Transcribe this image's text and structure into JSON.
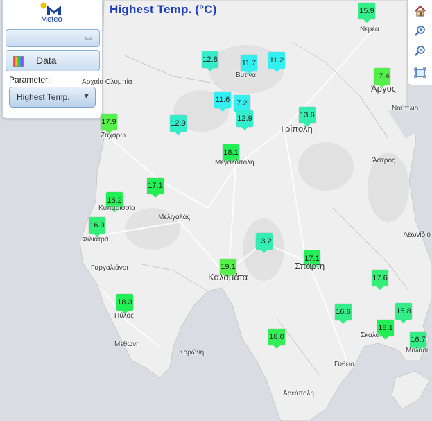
{
  "title": "Highest Temp. (°C)",
  "logo_text": "Meteo",
  "panel": {
    "data_label": "Data",
    "parameter_label": "Parameter:",
    "parameter_value": "Highest Temp."
  },
  "colors": {
    "title": "#1f3fbf",
    "sea": "#d9dde3",
    "land": "#efefef",
    "cyan_marker": "#33f0ef",
    "green_marker": "#22ee55",
    "lime_marker": "#55f04a"
  },
  "tool_icons": [
    "home-icon",
    "zoom-in-icon",
    "zoom-out-icon",
    "fit-extent-icon"
  ],
  "stations": [
    {
      "value": "15.9",
      "color": "#33ee88"
    },
    {
      "value": "12.8",
      "color": "#33eec8"
    },
    {
      "value": "11.7",
      "color": "#33f0f0"
    },
    {
      "value": "11.2",
      "color": "#33f0f0"
    },
    {
      "value": "17.4",
      "color": "#55f04a"
    },
    {
      "value": "11.6",
      "color": "#33f0f0"
    },
    {
      "value": "7.2",
      "color": "#33f0f0"
    },
    {
      "value": "12.9",
      "color": "#33eec8"
    },
    {
      "value": "13.6",
      "color": "#33eeb0"
    },
    {
      "value": "17.9",
      "color": "#55f04a"
    },
    {
      "value": "12.9",
      "color": "#33eec8"
    },
    {
      "value": "18.1",
      "color": "#22ee55"
    },
    {
      "value": "17.1",
      "color": "#22ee55"
    },
    {
      "value": "18.2",
      "color": "#22ee55"
    },
    {
      "value": "16.9",
      "color": "#33ee77"
    },
    {
      "value": "13.2",
      "color": "#33eeb0"
    },
    {
      "value": "17.1",
      "color": "#22ee55"
    },
    {
      "value": "19.1",
      "color": "#55f04a"
    },
    {
      "value": "17.6",
      "color": "#33ee77"
    },
    {
      "value": "18.3",
      "color": "#22ee55"
    },
    {
      "value": "16.6",
      "color": "#33ee88"
    },
    {
      "value": "15.8",
      "color": "#33ee88"
    },
    {
      "value": "18.1",
      "color": "#22ee55"
    },
    {
      "value": "18.0",
      "color": "#33ee55"
    },
    {
      "value": "16.7",
      "color": "#33ee88"
    }
  ],
  "places": [
    "Νεμέα",
    "Αρχαία Ολυμπία",
    "Βυτίνα",
    "Άργος",
    "Ναύπλιο",
    "Τρίπολη",
    "Ζαχάρω",
    "Μεγαλόπολη",
    "Άστρος",
    "Κυπαρισσία",
    "Μελιγαλάς",
    "Λεωνίδιο",
    "Φιλιατρά",
    "Σπάρτη",
    "Γαργαλιάνοι",
    "Καλαμάτα",
    "Πύλος",
    "Σκάλα",
    "Μεθώνη",
    "Κορώνη",
    "Μολάοι",
    "Γύθειο",
    "Αρεόπολη"
  ]
}
